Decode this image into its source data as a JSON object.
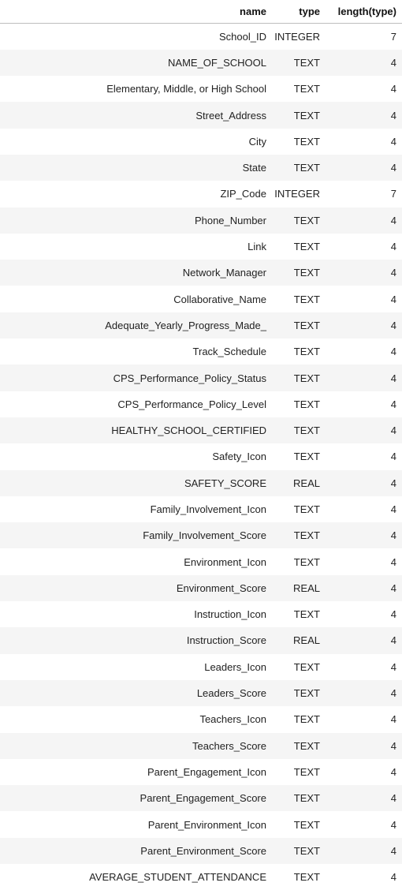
{
  "table": {
    "headers": {
      "name": "name",
      "type": "type",
      "length": "length(type)"
    },
    "rows": [
      {
        "name": "School_ID",
        "type": "INTEGER",
        "length": "7"
      },
      {
        "name": "NAME_OF_SCHOOL",
        "type": "TEXT",
        "length": "4"
      },
      {
        "name": "Elementary, Middle, or High School",
        "type": "TEXT",
        "length": "4"
      },
      {
        "name": "Street_Address",
        "type": "TEXT",
        "length": "4"
      },
      {
        "name": "City",
        "type": "TEXT",
        "length": "4"
      },
      {
        "name": "State",
        "type": "TEXT",
        "length": "4"
      },
      {
        "name": "ZIP_Code",
        "type": "INTEGER",
        "length": "7"
      },
      {
        "name": "Phone_Number",
        "type": "TEXT",
        "length": "4"
      },
      {
        "name": "Link",
        "type": "TEXT",
        "length": "4"
      },
      {
        "name": "Network_Manager",
        "type": "TEXT",
        "length": "4"
      },
      {
        "name": "Collaborative_Name",
        "type": "TEXT",
        "length": "4"
      },
      {
        "name": "Adequate_Yearly_Progress_Made_",
        "type": "TEXT",
        "length": "4"
      },
      {
        "name": "Track_Schedule",
        "type": "TEXT",
        "length": "4"
      },
      {
        "name": "CPS_Performance_Policy_Status",
        "type": "TEXT",
        "length": "4"
      },
      {
        "name": "CPS_Performance_Policy_Level",
        "type": "TEXT",
        "length": "4"
      },
      {
        "name": "HEALTHY_SCHOOL_CERTIFIED",
        "type": "TEXT",
        "length": "4"
      },
      {
        "name": "Safety_Icon",
        "type": "TEXT",
        "length": "4"
      },
      {
        "name": "SAFETY_SCORE",
        "type": "REAL",
        "length": "4"
      },
      {
        "name": "Family_Involvement_Icon",
        "type": "TEXT",
        "length": "4"
      },
      {
        "name": "Family_Involvement_Score",
        "type": "TEXT",
        "length": "4"
      },
      {
        "name": "Environment_Icon",
        "type": "TEXT",
        "length": "4"
      },
      {
        "name": "Environment_Score",
        "type": "REAL",
        "length": "4"
      },
      {
        "name": "Instruction_Icon",
        "type": "TEXT",
        "length": "4"
      },
      {
        "name": "Instruction_Score",
        "type": "REAL",
        "length": "4"
      },
      {
        "name": "Leaders_Icon",
        "type": "TEXT",
        "length": "4"
      },
      {
        "name": "Leaders_Score",
        "type": "TEXT",
        "length": "4"
      },
      {
        "name": "Teachers_Icon",
        "type": "TEXT",
        "length": "4"
      },
      {
        "name": "Teachers_Score",
        "type": "TEXT",
        "length": "4"
      },
      {
        "name": "Parent_Engagement_Icon",
        "type": "TEXT",
        "length": "4"
      },
      {
        "name": "Parent_Engagement_Score",
        "type": "TEXT",
        "length": "4"
      },
      {
        "name": "Parent_Environment_Icon",
        "type": "TEXT",
        "length": "4"
      },
      {
        "name": "Parent_Environment_Score",
        "type": "TEXT",
        "length": "4"
      },
      {
        "name": "AVERAGE_STUDENT_ATTENDANCE",
        "type": "TEXT",
        "length": "4"
      }
    ]
  }
}
